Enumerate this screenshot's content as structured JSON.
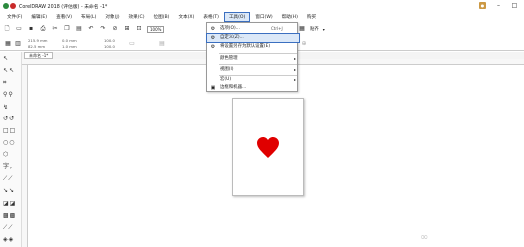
{
  "window": {
    "title": "CorelDRAW 2018 (评估版) - 未命名 -1*",
    "controls": [
      "–",
      "□",
      "✕"
    ]
  },
  "menubar": {
    "items": [
      "文件(F)",
      "编辑(E)",
      "查看(V)",
      "布局(L)",
      "对象(J)",
      "效果(C)",
      "位图(B)",
      "文本(X)",
      "表格(T)",
      "工具(O)",
      "窗口(W)",
      "帮助(H)",
      "购买"
    ],
    "active_index": 9
  },
  "toolbar": {
    "zoom_value": "100%",
    "snap_label": "贴齐",
    "icons": [
      "new-icon",
      "open-icon",
      "save-icon",
      "print-icon",
      "cut-icon",
      "copy-icon",
      "paste-icon",
      "undo-icon",
      "redo-icon",
      "search-icon",
      "import-icon",
      "export-icon"
    ]
  },
  "propbar": {
    "width_value": "215.9 mm",
    "height_value": "82.5 mm",
    "line1": "0.0 mm",
    "line2": "1.0 mm",
    "scale1": "100.0",
    "scale2": "100.0"
  },
  "doc_tab": {
    "label": "未命名 -1*"
  },
  "tools_menu": {
    "items": [
      {
        "label": "选项(O)...",
        "shortcut": "Ctrl+J",
        "icon": "gear-icon",
        "submenu": false
      },
      {
        "label": "自定义(Z)...",
        "shortcut": "",
        "icon": "gear-icon",
        "submenu": false,
        "highlighted": true
      },
      {
        "label": "将设置另存为默认设置(E)",
        "shortcut": "",
        "icon": "save-settings-icon",
        "submenu": false
      },
      {
        "label": "颜色管理",
        "shortcut": "",
        "icon": "",
        "submenu": true
      },
      {
        "label": "视图(I)",
        "shortcut": "",
        "icon": "",
        "submenu": true
      },
      {
        "label": "宏(U)",
        "shortcut": "",
        "icon": "",
        "submenu": true
      },
      {
        "label": "边框和机器...",
        "shortcut": "",
        "icon": "frame-icon",
        "submenu": false
      }
    ]
  },
  "canvas": {
    "shape_color": "#e00000"
  }
}
